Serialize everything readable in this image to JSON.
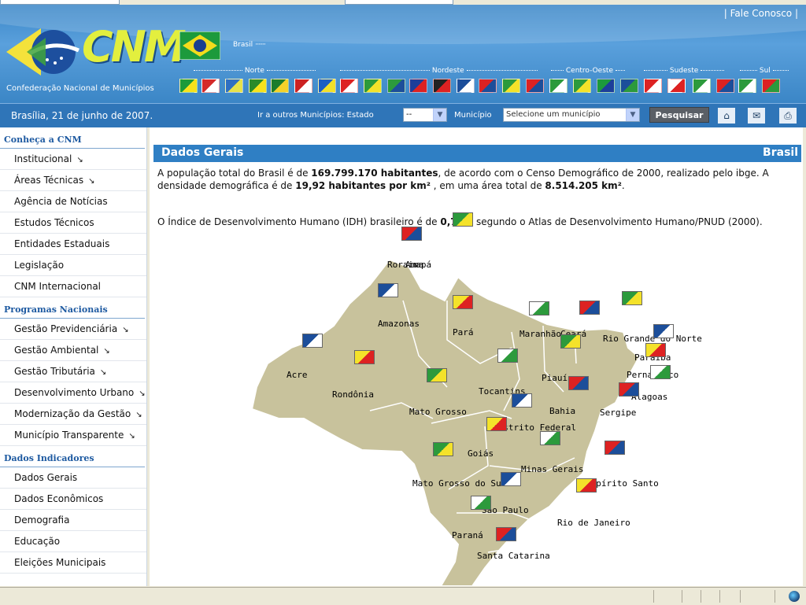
{
  "header": {
    "logo_text": "CNM",
    "logo_subtitle": "Confederação Nacional de Municípios",
    "fale_conosco": "| Fale Conosco |",
    "brasil_label": "Brasil",
    "regions": [
      "Norte",
      "Nordeste",
      "Centro-Oeste",
      "Sudeste",
      "Sul"
    ]
  },
  "navbar": {
    "date": "Brasília, 21 de junho de 2007.",
    "ir_label": "Ir a outros Municípios: Estado",
    "estado_value": "--",
    "municipio_label": "Município",
    "municipio_value": "Selecione um município",
    "search_button": "Pesquisar",
    "icons": [
      "home-icon",
      "mail-icon",
      "print-icon"
    ]
  },
  "sidebar": {
    "sections": [
      {
        "title": "Conheça a CNM",
        "items": [
          {
            "label": "Institucional",
            "arrow": true
          },
          {
            "label": "Áreas Técnicas",
            "arrow": true
          },
          {
            "label": "Agência de Notícias",
            "arrow": false
          },
          {
            "label": "Estudos Técnicos",
            "arrow": false
          },
          {
            "label": "Entidades Estaduais",
            "arrow": false
          },
          {
            "label": "Legislação",
            "arrow": false
          },
          {
            "label": "CNM Internacional",
            "arrow": false
          }
        ]
      },
      {
        "title": "Programas Nacionais",
        "items": [
          {
            "label": "Gestão Previdenciária",
            "arrow": true
          },
          {
            "label": "Gestão Ambiental",
            "arrow": true
          },
          {
            "label": "Gestão Tributária",
            "arrow": true
          },
          {
            "label": "Desenvolvimento Urbano",
            "arrow": true
          },
          {
            "label": "Modernização da Gestão",
            "arrow": true
          },
          {
            "label": "Município Transparente",
            "arrow": true
          }
        ]
      },
      {
        "title": "Dados Indicadores",
        "items": [
          {
            "label": "Dados Gerais",
            "arrow": false
          },
          {
            "label": "Dados Econômicos",
            "arrow": false
          },
          {
            "label": "Demografia",
            "arrow": false
          },
          {
            "label": "Educação",
            "arrow": false
          },
          {
            "label": "Eleições Municipais",
            "arrow": false
          }
        ]
      }
    ]
  },
  "main": {
    "title_left": "Dados Gerais",
    "title_right": "Brasil",
    "para1": {
      "t1": " A população total do Brasil é de ",
      "b1": "169.799.170 habitantes",
      "t2": ", de acordo com o Censo Demográfico de 2000, realizado pelo ibge. A densidade demográfica é de ",
      "b2": "19,92 habitantes por km²",
      "t3": " , em uma área total de ",
      "b3": "8.514.205 km²",
      "t4": "."
    },
    "para2": {
      "t1": "O Índice de Desenvolvimento Humano (IDH) brasileiro é de ",
      "b1": "0,766",
      "t2": ", segundo o Atlas de Desenvolvimento Humano/PNUD (2000)."
    }
  },
  "map": {
    "states": [
      "Roraima",
      "Amapá",
      "Amazonas",
      "Pará",
      "Maranhão",
      "Ceará",
      "Rio Grande do Norte",
      "Paraíba",
      "Pernambuco",
      "Alagoas",
      "Sergipe",
      "Piauí",
      "Acre",
      "Rondônia",
      "Tocantins",
      "Bahia",
      "Mato Grosso",
      "Distrito Federal",
      "Goiás",
      "Minas Gerais",
      "Espírito Santo",
      "Mato Grosso do Sul",
      "São Paulo",
      "Rio de Janeiro",
      "Paraná",
      "Santa Catarina"
    ]
  },
  "colors": {
    "header_blue": "#3a86c7",
    "navbar_blue": "#2f75b8",
    "title_blue": "#2f7fc4",
    "map_land": "#c8c29c"
  }
}
